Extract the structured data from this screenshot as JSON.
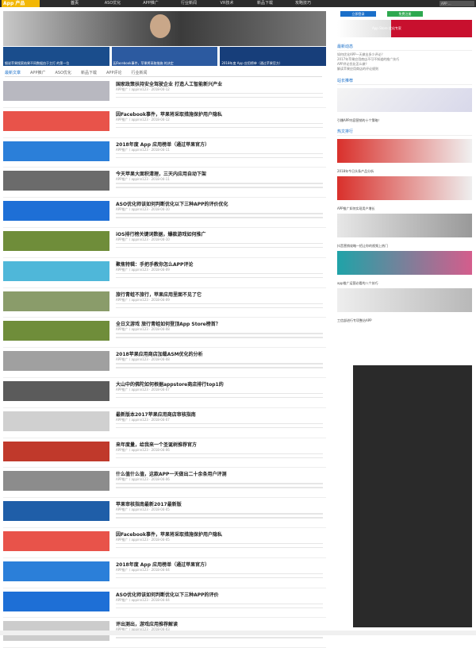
{
  "logo": {
    "text": "App 产品"
  },
  "nav": [
    {
      "label": "首页"
    },
    {
      "label": "ASO优化"
    },
    {
      "label": "APP推广"
    },
    {
      "label": "行业新闻"
    },
    {
      "label": "VR技术"
    },
    {
      "label": "新品下载"
    },
    {
      "label": "攻略技巧"
    }
  ],
  "topsearch": {
    "placeholder": "APP ..."
  },
  "thumbs": [
    {
      "caption": "细说苹果搜索结果不同数据由于主打 的第一位"
    },
    {
      "caption": "因Facebook事件，苹果将采取措施 的决定"
    },
    {
      "caption": "2018年度 App 应用榜单（通过苹果官方）"
    }
  ],
  "tabs": [
    {
      "label": "最新文章"
    },
    {
      "label": "APP推广"
    },
    {
      "label": "ASO优化"
    },
    {
      "label": "新品下载"
    },
    {
      "label": "APP评论"
    },
    {
      "label": "行业新闻"
    }
  ],
  "list": [
    {
      "title": "国家政策扶持安全驾驶企业 打造人工智能新兴产业",
      "meta": "APP推广 / appinn123 · 2018-04-12"
    },
    {
      "title": "因Facebook事件，苹果将采取措施保护用户隐私",
      "meta": "APP推广 / appinn123 · 2018-04-12"
    },
    {
      "title": "2018年度 App 应用榜单（通过苹果官方）",
      "meta": "APP推广 / appinn123 · 2018-04-11"
    },
    {
      "title": "今天苹果大面积清理，三天内应用自动下架",
      "meta": "APP推广 / appinn123 · 2018-04-11"
    },
    {
      "title": "ASO优化师该如何判断优化以下三种APP的评价优化",
      "meta": "APP推广 / appinn123 · 2018-04-10"
    },
    {
      "title": "iOS排行榜关键词数据，爆款游戏如何推广",
      "meta": "APP推广 / appinn123 · 2018-04-10"
    },
    {
      "title": "聚焦特辑：手把手教你怎么APP评论",
      "meta": "APP推广 / appinn123 · 2018-04-09"
    },
    {
      "title": "旅行青蛙不旅行，苹果应用里面不见了它",
      "meta": "APP推广 / appinn123 · 2018-04-09"
    },
    {
      "title": "全日文游戏 旅行青蛙如何登顶App Store榜首？",
      "meta": "APP推广 / appinn123 · 2018-04-08"
    },
    {
      "title": "2018苹果应用商店加载ASM优化的分析",
      "meta": "APP推广 / appinn123 · 2018-04-08"
    },
    {
      "title": "大山中的佛陀如何根据appstore商店排行top1的",
      "meta": "APP推广 / appinn123 · 2018-04-07"
    },
    {
      "title": "最新版本2017苹果应用商店审核指南",
      "meta": "APP推广 / appinn123 · 2018-04-07"
    },
    {
      "title": "来年度量，给我来一个圣诞树推荐官方",
      "meta": "APP推广 / appinn123 · 2018-04-06"
    },
    {
      "title": "什么值什么值，这款APP一天做出二十余条用户评测",
      "meta": "APP推广 / appinn123 · 2018-04-06"
    },
    {
      "title": "苹果审核指南最新2017最新版",
      "meta": "APP推广 / appinn123 · 2018-04-05"
    },
    {
      "title": "因Facebook事件，苹果将采取措施保护用户隐私",
      "meta": "APP推广 / appinn123 · 2018-04-05"
    },
    {
      "title": "2018年度 App 应用榜单（通过苹果官方）",
      "meta": "APP推广 / appinn123 · 2018-04-04"
    },
    {
      "title": "ASO优化师该如何判断优化以下三种APP的评价",
      "meta": "APP推广 / appinn123 · 2018-04-04"
    },
    {
      "title": "评出测出，游戏应用推荐解读",
      "meta": "APP推广 / appinn123 · 2018-04-03"
    }
  ],
  "sidebar": {
    "btn1": "立即登录",
    "btn2": "免费注册",
    "banner": "App Store 优化专家",
    "section1": "最新动态",
    "feed": [
      "如何优化APP一天做出多少评论？",
      "2017年苹果应用商店不可不知道的推广技巧",
      "APP评论优化怎么做？",
      "解读苹果应用商店的评论规则"
    ],
    "section2": "站长推荐",
    "p1": "引爆APP内容营销的十个策略！",
    "section3": "热文排行",
    "p2": "2018年今日头条产品分析",
    "p3": "APP推广如何实现用户增长",
    "p4": "抖音营销攻略一招让你的视频上热门",
    "p5": "app推广运营必看的八个技巧",
    "p6": "工信部进行专项整治APP"
  }
}
